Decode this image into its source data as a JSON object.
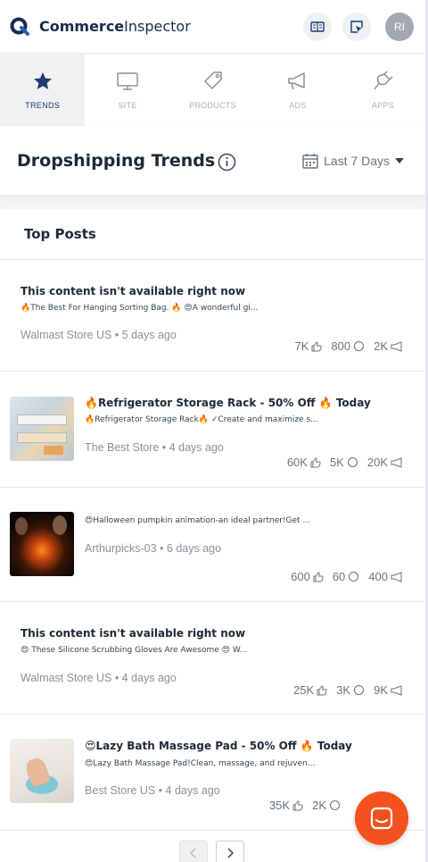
{
  "brand": {
    "name_bold": "Commerce",
    "name_light": "Inspector"
  },
  "header": {
    "avatar_initials": "RI",
    "icons": [
      "book-icon",
      "cursor-box-icon"
    ]
  },
  "nav": {
    "items": [
      {
        "label": "TRENDS",
        "icon": "star-icon",
        "active": true
      },
      {
        "label": "SITE",
        "icon": "monitor-icon",
        "active": false
      },
      {
        "label": "PRODUCTS",
        "icon": "tag-icon",
        "active": false
      },
      {
        "label": "ADS",
        "icon": "megaphone-icon",
        "active": false
      },
      {
        "label": "APPS",
        "icon": "plug-icon",
        "active": false
      }
    ]
  },
  "page": {
    "title": "Dropshipping Trends",
    "date_range": "Last 7 Days"
  },
  "top_posts": {
    "title": "Top Posts",
    "posts": [
      {
        "title": "This content isn't available right now",
        "description": "🔥The Best For Hanging Sorting Bag. 🔥 😍A wonderful gi...",
        "store": "Walmast Store US",
        "age": "5 days ago",
        "likes": "7K",
        "comments": "800",
        "shares": "2K",
        "has_thumb": false
      },
      {
        "title": "🔥Refrigerator Storage Rack - 50% Off 🔥 Today",
        "description": "🔥Refrigerator Storage Rack🔥 ✓Create and maximize s...",
        "store": "The Best Store",
        "age": "4 days ago",
        "likes": "60K",
        "comments": "5K",
        "shares": "20K",
        "has_thumb": true
      },
      {
        "title": "",
        "description": "😍Halloween pumpkin animation-an ideal partner!Get ...",
        "store": "Arthurpicks-03",
        "age": "6 days ago",
        "likes": "600",
        "comments": "60",
        "shares": "400",
        "has_thumb": true
      },
      {
        "title": "This content isn't available right now",
        "description": "😍 These Silicone Scrubbing Gloves Are Awesome 😍 W...",
        "store": "Walmast Store US",
        "age": "4 days ago",
        "likes": "25K",
        "comments": "3K",
        "shares": "9K",
        "has_thumb": false
      },
      {
        "title": "😍Lazy Bath Massage Pad - 50% Off 🔥 Today",
        "description": "😍Lazy Bath Massage Pad!Clean, massage, and rejuven...",
        "store": "Best Store US",
        "age": "4 days ago",
        "likes": "35K",
        "comments": "2K",
        "shares": "",
        "has_thumb": true
      }
    ]
  },
  "pagination": {
    "prev": "‹",
    "next": "›"
  },
  "colors": {
    "brand_navy": "#1a2b4c",
    "accent_orange": "#f4511e"
  }
}
